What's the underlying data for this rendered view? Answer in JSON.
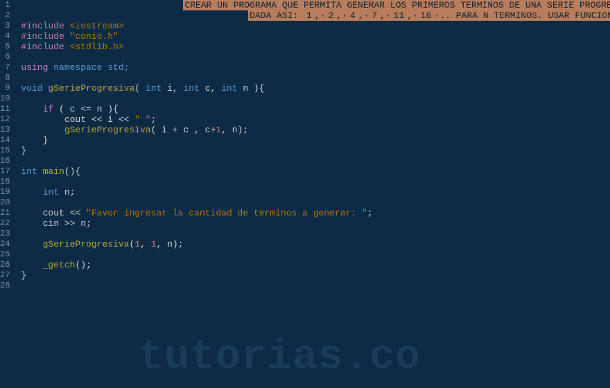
{
  "colors": {
    "background": "#0d2b45",
    "gutter_fg": "#7a8fa6",
    "comment_bg": "#b87d5c",
    "keyword": "#c586c0",
    "type": "#569cd6",
    "string": "#b8770a",
    "number": "#ce7a5c",
    "function": "#b8a640",
    "identifier": "#9cdcfe"
  },
  "watermark": "tutorias.co",
  "line_count": 28,
  "code_lines": {
    "1": {
      "indent": 30,
      "segments": [
        {
          "t": "CREAR UN PROGRAMA QUE PERMITA GENERAR LOS PRIMEROS TERMINOS DE UNA SERIE PROGRESIVA",
          "cls": "hl-comment-block"
        }
      ]
    },
    "2": {
      "indent": 42,
      "segments": [
        {
          "t": "DADA ASI: ",
          "cls": "hl-comment-block"
        },
        {
          "t": "1",
          "cls": "hl-comment-block num-in"
        },
        {
          "t": ",·",
          "cls": "hl-comment-block"
        },
        {
          "t": "2",
          "cls": "hl-comment-block num-in"
        },
        {
          "t": ",·",
          "cls": "hl-comment-block"
        },
        {
          "t": "4",
          "cls": "hl-comment-block num-in"
        },
        {
          "t": ",·",
          "cls": "hl-comment-block"
        },
        {
          "t": "7",
          "cls": "hl-comment-block num-in"
        },
        {
          "t": ",·",
          "cls": "hl-comment-block"
        },
        {
          "t": "11",
          "cls": "hl-comment-block num-in"
        },
        {
          "t": ",·",
          "cls": "hl-comment-block"
        },
        {
          "t": "16",
          "cls": "hl-comment-block num-in"
        },
        {
          "t": "·.. PARA N TERMINOS. USAR FUNCION RECURSIVA",
          "cls": "hl-comment-block"
        }
      ]
    },
    "3": {
      "indent": 0,
      "segments": [
        {
          "t": "#include ",
          "cls": "include-kw"
        },
        {
          "t": "<iostream>",
          "cls": "include-lib"
        }
      ]
    },
    "4": {
      "indent": 0,
      "segments": [
        {
          "t": "#include ",
          "cls": "include-kw"
        },
        {
          "t": "\"conio.h\"",
          "cls": "str"
        }
      ]
    },
    "5": {
      "indent": 0,
      "segments": [
        {
          "t": "#include ",
          "cls": "include-kw"
        },
        {
          "t": "<stdlib.h>",
          "cls": "include-lib"
        }
      ]
    },
    "6": {
      "indent": 0,
      "segments": []
    },
    "7": {
      "indent": 0,
      "segments": [
        {
          "t": "using",
          "cls": "kw"
        },
        {
          "t": " namespace std;",
          "cls": "type"
        }
      ]
    },
    "8": {
      "indent": 0,
      "segments": []
    },
    "9": {
      "indent": 0,
      "segments": [
        {
          "t": "void ",
          "cls": "type"
        },
        {
          "t": "gSerieProgresiva",
          "cls": "fn"
        },
        {
          "t": "( ",
          "cls": "op"
        },
        {
          "t": "int",
          "cls": "type"
        },
        {
          "t": " i, ",
          "cls": "op"
        },
        {
          "t": "int",
          "cls": "type"
        },
        {
          "t": " c, ",
          "cls": "op"
        },
        {
          "t": "int",
          "cls": "type"
        },
        {
          "t": " n ){",
          "cls": "op"
        }
      ]
    },
    "10": {
      "indent": 0,
      "segments": []
    },
    "11": {
      "indent": 4,
      "segments": [
        {
          "t": "if",
          "cls": "kw"
        },
        {
          "t": " ( c <= n ){",
          "cls": "op"
        }
      ]
    },
    "12": {
      "indent": 8,
      "segments": [
        {
          "t": "cout << i << ",
          "cls": "op"
        },
        {
          "t": "\" \"",
          "cls": "str"
        },
        {
          "t": ";",
          "cls": "op"
        }
      ]
    },
    "13": {
      "indent": 8,
      "segments": [
        {
          "t": "gSerieProgresiva",
          "cls": "fn"
        },
        {
          "t": "( i + c , c+",
          "cls": "op"
        },
        {
          "t": "1",
          "cls": "num"
        },
        {
          "t": ", n);",
          "cls": "op"
        }
      ]
    },
    "14": {
      "indent": 4,
      "segments": [
        {
          "t": "}",
          "cls": "op"
        }
      ]
    },
    "15": {
      "indent": 0,
      "segments": [
        {
          "t": "}",
          "cls": "op"
        }
      ]
    },
    "16": {
      "indent": 0,
      "segments": []
    },
    "17": {
      "indent": 0,
      "segments": [
        {
          "t": "int ",
          "cls": "type"
        },
        {
          "t": "main",
          "cls": "fn"
        },
        {
          "t": "(){",
          "cls": "op"
        }
      ]
    },
    "18": {
      "indent": 0,
      "segments": []
    },
    "19": {
      "indent": 4,
      "segments": [
        {
          "t": "int",
          "cls": "type"
        },
        {
          "t": " n;",
          "cls": "op"
        }
      ]
    },
    "20": {
      "indent": 0,
      "segments": []
    },
    "21": {
      "indent": 4,
      "segments": [
        {
          "t": "cout << ",
          "cls": "op"
        },
        {
          "t": "\"Favor ingresar la cantidad de terminos a generar: \"",
          "cls": "str"
        },
        {
          "t": ";",
          "cls": "op"
        }
      ]
    },
    "22": {
      "indent": 4,
      "segments": [
        {
          "t": "cin >> n;",
          "cls": "op"
        }
      ]
    },
    "23": {
      "indent": 0,
      "segments": []
    },
    "24": {
      "indent": 4,
      "segments": [
        {
          "t": "gSerieProgresiva",
          "cls": "fn"
        },
        {
          "t": "(",
          "cls": "op"
        },
        {
          "t": "1",
          "cls": "num"
        },
        {
          "t": ", ",
          "cls": "op"
        },
        {
          "t": "1",
          "cls": "num"
        },
        {
          "t": ", n);",
          "cls": "op"
        }
      ]
    },
    "25": {
      "indent": 0,
      "segments": []
    },
    "26": {
      "indent": 4,
      "segments": [
        {
          "t": "_getch",
          "cls": "fn"
        },
        {
          "t": "();",
          "cls": "op"
        }
      ]
    },
    "27": {
      "indent": 0,
      "segments": [
        {
          "t": "}",
          "cls": "op"
        }
      ]
    },
    "28": {
      "indent": 0,
      "segments": []
    }
  }
}
